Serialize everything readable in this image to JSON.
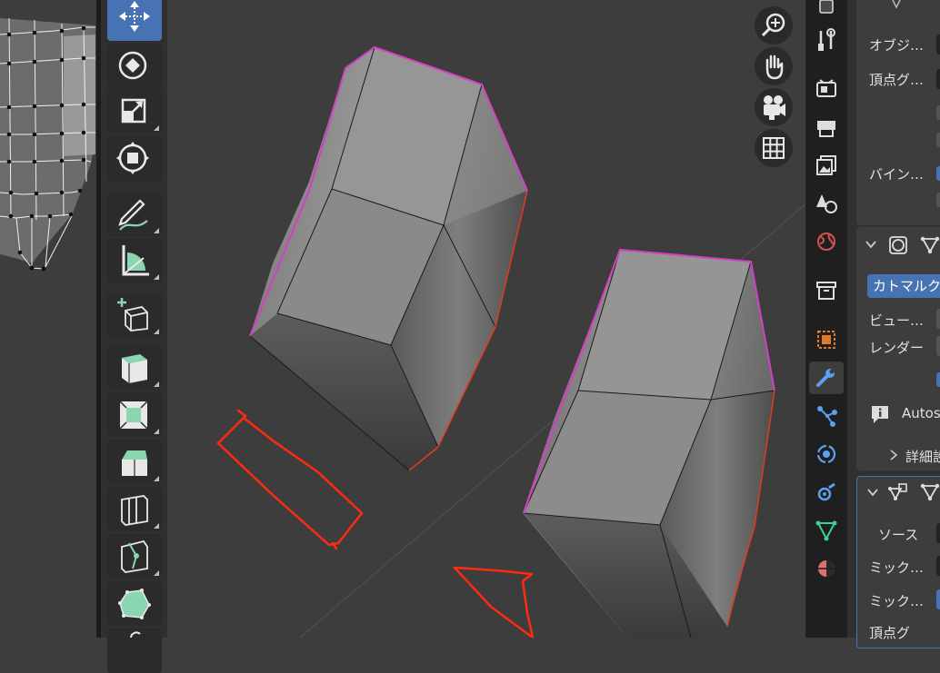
{
  "properties": {
    "panel1": {
      "object_label": "オブジ…",
      "vertex_group_label": "頂点グ…",
      "bind_label": "バイン…"
    },
    "subdivision": {
      "type_button": "カトマルク",
      "viewport_label": "ビュー…",
      "render_label": "レンダー",
      "autosmooth_text": "Autos",
      "details_label": "詳細設"
    },
    "data_transfer": {
      "source_label": "ソース",
      "mix1_label": "ミック…",
      "mix2_label": "ミック…",
      "vertex_group_label": "頂点グ"
    }
  },
  "colors": {
    "viewport_bg": "#3d3d3d",
    "active_blue": "#4772b3",
    "selection_edge": "#d43fc8",
    "annotation_red": "#ff2a10",
    "gizmo_mint": "#8ad6b0"
  },
  "toolbar_icons": [
    "move-icon",
    "rotate-icon",
    "scale-icon",
    "transform-icon",
    "annotate-icon",
    "measure-icon",
    "add-cube-icon",
    "extrude-icon",
    "inset-icon",
    "bevel-icon",
    "loop-cut-icon",
    "knife-icon",
    "poly-build-icon"
  ],
  "nav_icons": [
    "zoom-icon",
    "hand-pan-icon",
    "camera-icon",
    "grid-icon"
  ]
}
